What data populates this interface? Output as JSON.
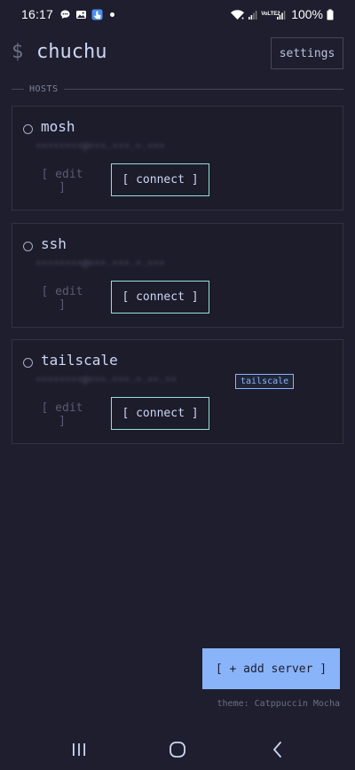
{
  "status_bar": {
    "time": "16:17",
    "left_icons": [
      "chat-bubble-icon",
      "image-icon",
      "touch-icon",
      "dot-icon"
    ],
    "right_icons": [
      "wifi-icon",
      "signal-icon",
      "volte-icon",
      "signal-icon-2"
    ],
    "volte_text": "VoLTE2",
    "battery": "100%"
  },
  "header": {
    "prompt": "$",
    "title": "chuchu",
    "settings_label": "settings"
  },
  "hosts_section": {
    "label": "HOSTS"
  },
  "hosts": [
    {
      "name": "mosh",
      "address": "••••••••@•••.•••.•.•••",
      "tag": "",
      "edit_label": "[ edit ]",
      "connect_label": "[ connect ]"
    },
    {
      "name": "ssh",
      "address": "••••••••@•••.•••.•.•••",
      "tag": "",
      "edit_label": "[ edit ]",
      "connect_label": "[ connect ]"
    },
    {
      "name": "tailscale",
      "address": "••••••••@•••.•••.•.••.••",
      "tag": "tailscale",
      "edit_label": "[ edit ]",
      "connect_label": "[ connect ]"
    }
  ],
  "add_server_label": "[ + add server ]",
  "theme_label": "theme: Catppuccin Mocha",
  "colors": {
    "background": "#1e1e2e",
    "accent": "#89b4fa",
    "connect_border": "#94e2d5",
    "text": "#cdd6f4"
  },
  "nav": {
    "icons": [
      "recents-icon",
      "home-icon",
      "back-icon"
    ]
  }
}
